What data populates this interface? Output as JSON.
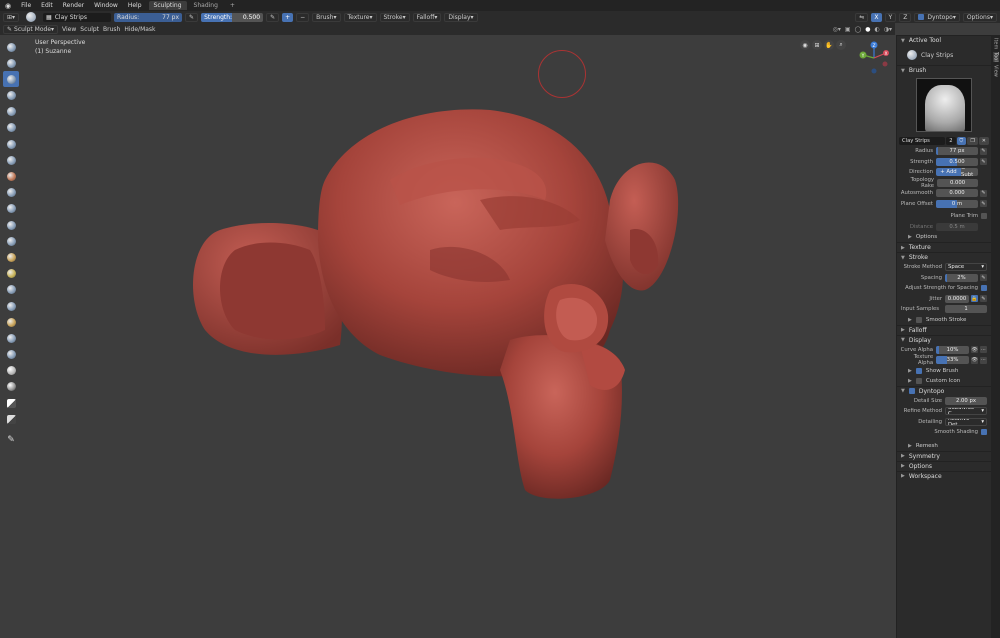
{
  "menu": {
    "items": [
      "File",
      "Edit",
      "Render",
      "Window",
      "Help"
    ],
    "workspaces": [
      "Sculpting",
      "Shading"
    ],
    "add": "+"
  },
  "toolheader": {
    "tool_name": "Clay Strips",
    "radius_label": "Radius:",
    "radius_value": "77 px",
    "strength_label": "Strength:",
    "strength_value": "0.500",
    "dropdowns": [
      "Brush",
      "Texture",
      "Stroke",
      "Falloff",
      "Display"
    ],
    "axes": [
      "X",
      "Y",
      "Z"
    ],
    "dyntopo": "Dyntopo",
    "options": "Options"
  },
  "modeheader": {
    "mode": "Sculpt Mode",
    "menus": [
      "View",
      "Sculpt",
      "Brush",
      "Hide/Mask"
    ]
  },
  "viewport": {
    "perspective": "User Perspective",
    "object": "(1) Suzanne",
    "gizmo": {
      "x": "X",
      "y": "Y",
      "z": "Z"
    }
  },
  "tabs": [
    "Item",
    "Tool",
    "View"
  ],
  "panel": {
    "active_tool": {
      "title": "Active Tool",
      "tool": "Clay Strips"
    },
    "brush": {
      "title": "Brush",
      "name": "Clay Strips",
      "users": "2",
      "radius_label": "Radius",
      "radius": "77 px",
      "strength_label": "Strength",
      "strength": "0.500",
      "direction_label": "Direction",
      "add": "+ Add",
      "subtract": "− Subt",
      "rake_label": "Topology Rake",
      "rake": "0.000",
      "autosmooth_label": "Autosmooth",
      "autosmooth": "0.000",
      "plane_offset_label": "Plane Offset",
      "plane_offset": "0 m",
      "plane_trim": "Plane Trim",
      "distance_label": "Distance",
      "distance": "0.5 m",
      "options": "Options"
    },
    "texture": "Texture",
    "stroke": {
      "title": "Stroke",
      "method_label": "Stroke Method",
      "method": "Space",
      "spacing_label": "Spacing",
      "spacing": "2%",
      "adjust": "Adjust Strength for Spacing",
      "jitter_label": "Jitter",
      "jitter": "0.0000",
      "input_samples_label": "Input Samples",
      "input_samples": "1",
      "smooth_stroke": "Smooth Stroke"
    },
    "falloff": "Falloff",
    "display": {
      "title": "Display",
      "curve_alpha_label": "Curve Alpha",
      "curve_alpha": "10%",
      "texture_alpha_label": "Texture Alpha",
      "texture_alpha": "33%",
      "show_brush": "Show Brush",
      "custom_icon": "Custom Icon"
    },
    "dyntopo": {
      "title": "Dyntopo",
      "detail_size_label": "Detail Size",
      "detail_size": "2.00 px",
      "refine_label": "Refine Method",
      "refine": "Subdivide C...",
      "detailing_label": "Detailing",
      "detailing": "Relative Det...",
      "smooth_shading": "Smooth Shading",
      "remesh": "Remesh"
    },
    "symmetry": "Symmetry",
    "options": "Options",
    "workspace": "Workspace"
  },
  "colors": {
    "accent": "#4772b3",
    "model": "#b04a40",
    "background": "#3d3d3d"
  }
}
